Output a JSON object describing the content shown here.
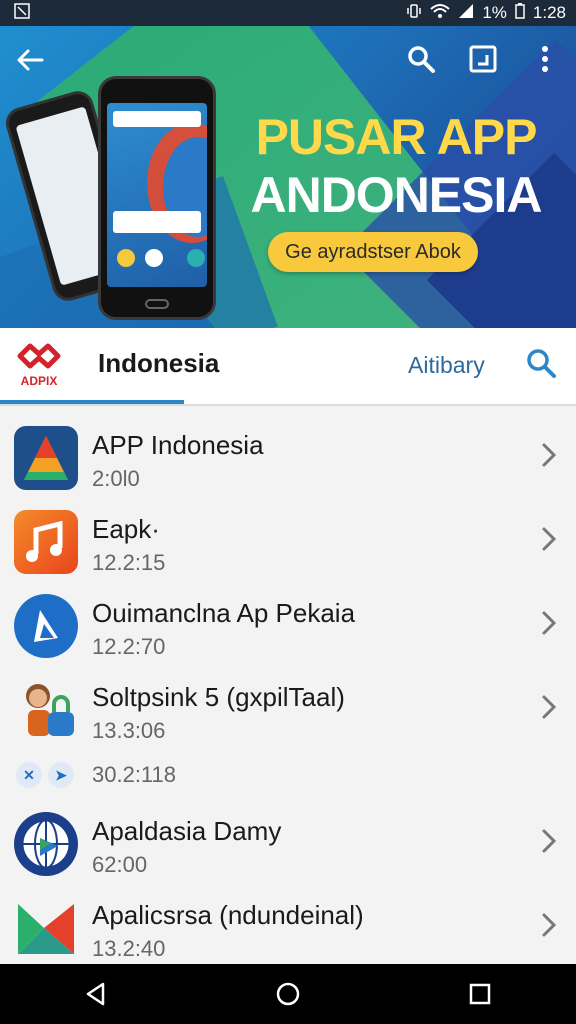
{
  "status_bar": {
    "battery_text": "1%",
    "time": "1:28"
  },
  "banner": {
    "title_line1": "PUSAR APP",
    "title_line2": "ANDONESIA",
    "cta_label": "Ge ayradstser Abok"
  },
  "tabs": {
    "brand_label": "ADPIX",
    "active_label": "Indonesia",
    "other_label": "Aitibary"
  },
  "apps": [
    {
      "title": "APP Indonesia",
      "sub": "2:0l0"
    },
    {
      "title": "Eapk·",
      "sub": "12.2:15"
    },
    {
      "title": "Ouimanclna Ap Pekaia",
      "sub": "12.2:70"
    },
    {
      "title": "Soltpsink 5 (gxpilTaal)",
      "sub": "13.3:06"
    },
    {
      "title": "",
      "sub": "30.2:118"
    },
    {
      "title": "Apaldasia Damy",
      "sub": "62:00"
    },
    {
      "title": "Apalicsrsa (ndundeinal)",
      "sub": "13.2:40"
    }
  ],
  "colors": {
    "accent": "#2c86c7",
    "banner_title_yellow": "#ffd94a",
    "cta_yellow": "#f8c93c",
    "brand_red": "#d2232a"
  }
}
